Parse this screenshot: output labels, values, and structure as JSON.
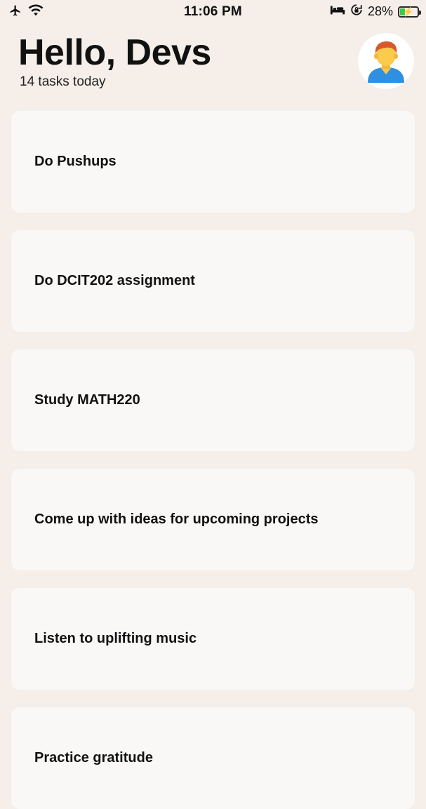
{
  "status_bar": {
    "time": "11:06 PM",
    "battery_text": "28%",
    "battery_level": 0.28,
    "icons": [
      "airplane-icon",
      "wifi-icon",
      "bed-icon",
      "orientation-lock-icon",
      "battery-icon"
    ]
  },
  "header": {
    "greeting": "Hello, Devs",
    "subtitle": "14 tasks today"
  },
  "tasks": [
    {
      "title": "Do Pushups"
    },
    {
      "title": "Do DCIT202 assignment"
    },
    {
      "title": "Study MATH220"
    },
    {
      "title": "Come up with ideas for upcoming projects"
    },
    {
      "title": "Listen to uplifting music"
    },
    {
      "title": "Practice gratitude"
    }
  ],
  "colors": {
    "background": "#f5eee9",
    "card": "#f9f8f6",
    "battery_green": "#3cc948"
  }
}
